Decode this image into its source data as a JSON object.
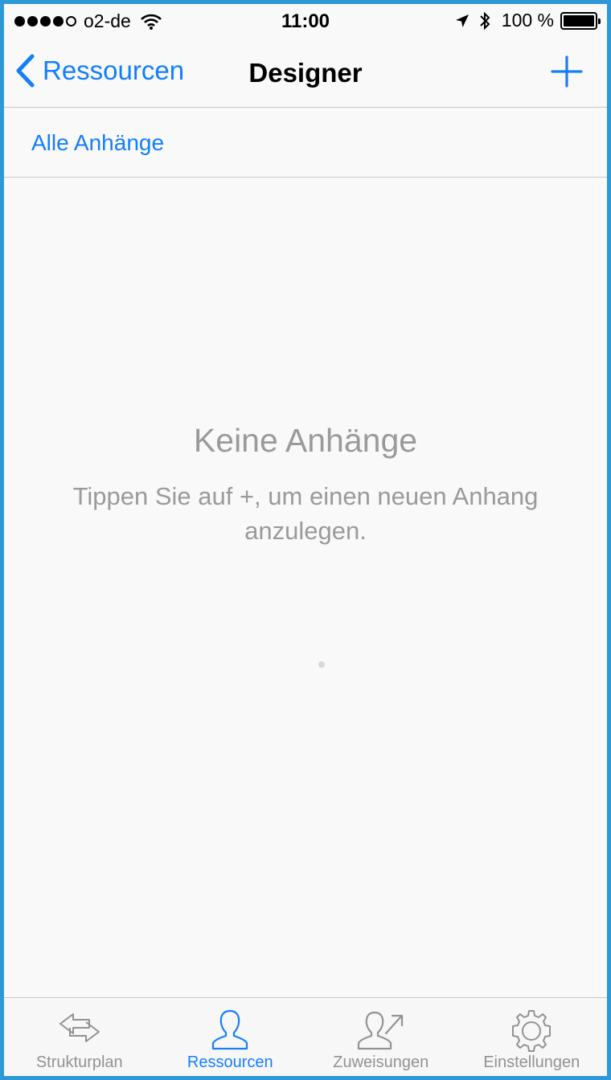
{
  "status_bar": {
    "carrier": "o2-de",
    "time": "11:00",
    "battery": "100 %"
  },
  "nav": {
    "back_label": "Ressourcen",
    "title": "Designer",
    "add_icon": "plus-icon"
  },
  "filter": {
    "label": "Alle Anhänge"
  },
  "empty_state": {
    "title": "Keine Anhänge",
    "hint": "Tippen Sie auf +, um einen neuen Anhang anzulegen."
  },
  "tabs": [
    {
      "label": "Strukturplan",
      "icon": "arrows-swap-icon",
      "active": false
    },
    {
      "label": "Ressourcen",
      "icon": "person-icon",
      "active": true
    },
    {
      "label": "Zuweisungen",
      "icon": "person-assign-icon",
      "active": false
    },
    {
      "label": "Einstellungen",
      "icon": "gear-icon",
      "active": false
    }
  ],
  "colors": {
    "accent": "#147efb",
    "frame": "#2f98d6",
    "muted": "#9a9a9a"
  }
}
